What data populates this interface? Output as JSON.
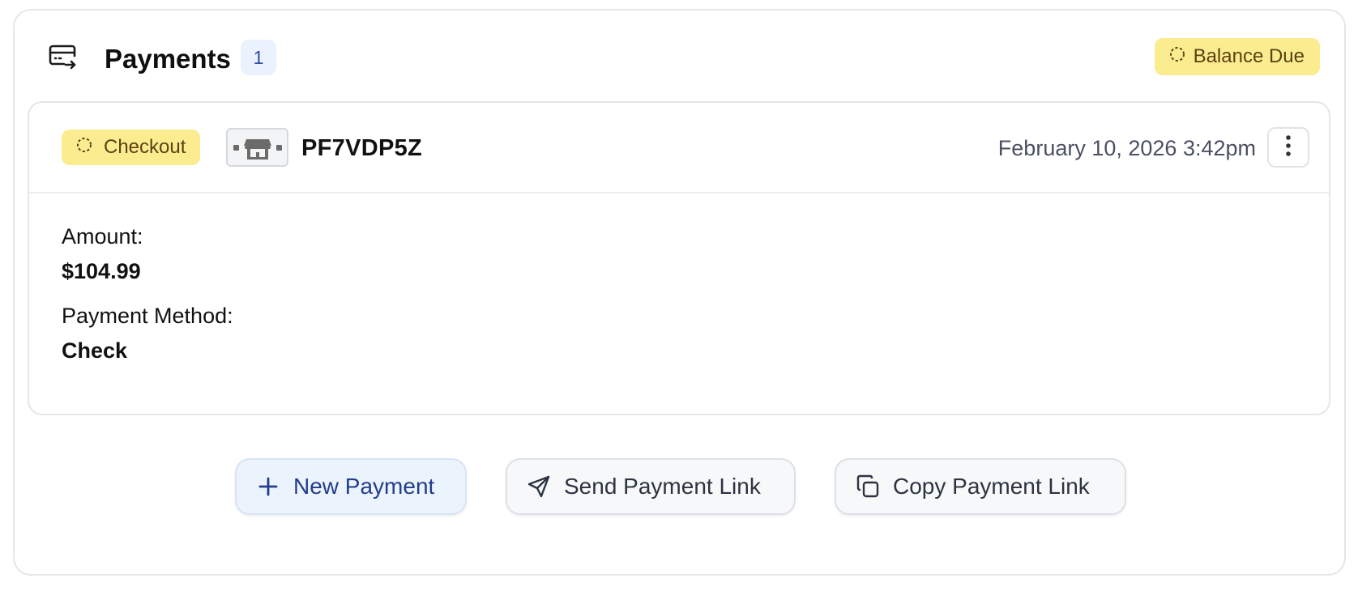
{
  "panel": {
    "title": "Payments",
    "count": "1",
    "balance_status": "Balance Due",
    "icons": {
      "header": "card-transfer-icon",
      "status": "spinner-icon"
    }
  },
  "payment": {
    "status": "Checkout",
    "source_icon": "storefront-icon",
    "id": "PF7VDP5Z",
    "date": "February 10, 2026 3:42pm",
    "menu_icon": "kebab-menu-icon",
    "amount_label": "Amount:",
    "amount_value": "$104.99",
    "method_label": "Payment Method:",
    "method_value": "Check"
  },
  "actions": {
    "new_payment": "New Payment",
    "send_link": "Send Payment Link",
    "copy_link": "Copy Payment Link",
    "icons": {
      "new": "plus-icon",
      "send": "send-icon",
      "copy": "copy-icon"
    }
  },
  "colors": {
    "badge_yellow": "#fbec90",
    "badge_text": "#5c4112",
    "count_badge_bg": "#eaf2fd",
    "primary_text": "#233e8b",
    "border": "#e4e6ea"
  }
}
